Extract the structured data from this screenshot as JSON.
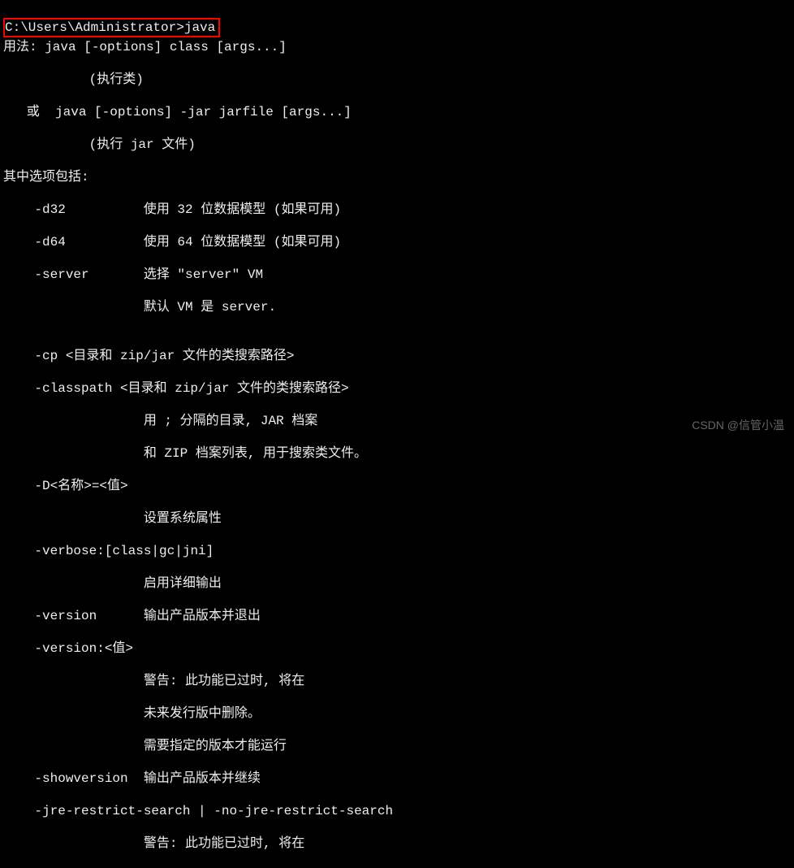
{
  "prompt": "C:\\Users\\Administrator>",
  "command": "java",
  "lines": [
    "用法: java [-options] class [args...]",
    "           (执行类)",
    "   或  java [-options] -jar jarfile [args...]",
    "           (执行 jar 文件)",
    "其中选项包括:",
    "    -d32          使用 32 位数据模型 (如果可用)",
    "    -d64          使用 64 位数据模型 (如果可用)",
    "    -server       选择 \"server\" VM",
    "                  默认 VM 是 server.",
    "",
    "    -cp <目录和 zip/jar 文件的类搜索路径>",
    "    -classpath <目录和 zip/jar 文件的类搜索路径>",
    "                  用 ; 分隔的目录, JAR 档案",
    "                  和 ZIP 档案列表, 用于搜索类文件。",
    "    -D<名称>=<值>",
    "                  设置系统属性",
    "    -verbose:[class|gc|jni]",
    "                  启用详细输出",
    "    -version      输出产品版本并退出",
    "    -version:<值>",
    "                  警告: 此功能已过时, 将在",
    "                  未来发行版中删除。",
    "                  需要指定的版本才能运行",
    "    -showversion  输出产品版本并继续",
    "    -jre-restrict-search | -no-jre-restrict-search",
    "                  警告: 此功能已过时, 将在"
  ],
  "watermark": "CSDN @信管小温"
}
